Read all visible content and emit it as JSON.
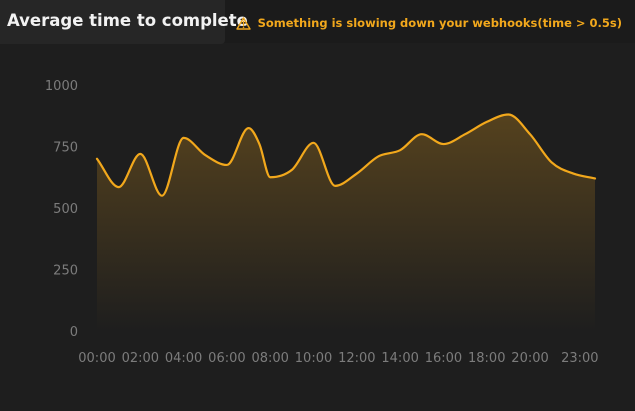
{
  "header": {
    "title": "Average time to complete",
    "warning_text": "Something is slowing down your webhooks(time > 0.5s)",
    "warning_icon": "warning-triangle-icon",
    "warning_color": "#f2a81c"
  },
  "chart_data": {
    "type": "area",
    "title": "Average time to complete",
    "xlabel": "",
    "ylabel": "",
    "ylim": [
      0,
      1000
    ],
    "xlim": [
      0,
      23
    ],
    "y_ticks": [
      0,
      250,
      500,
      750,
      1000
    ],
    "x_ticks": [
      {
        "value": 0,
        "label": "00:00"
      },
      {
        "value": 2,
        "label": "02:00"
      },
      {
        "value": 4,
        "label": "04:00"
      },
      {
        "value": 6,
        "label": "06:00"
      },
      {
        "value": 8,
        "label": "08:00"
      },
      {
        "value": 10,
        "label": "10:00"
      },
      {
        "value": 12,
        "label": "12:00"
      },
      {
        "value": 14,
        "label": "14:00"
      },
      {
        "value": 16,
        "label": "16:00"
      },
      {
        "value": 18,
        "label": "18:00"
      },
      {
        "value": 20,
        "label": "20:00"
      },
      {
        "value": 22.3,
        "label": "23:00"
      }
    ],
    "grid": false,
    "legend": "none",
    "series": [
      {
        "color": "#f2a81c",
        "x": [
          0,
          1,
          2,
          3,
          4,
          5,
          6,
          7,
          7.5,
          8,
          9,
          10,
          11,
          12,
          13,
          14,
          15,
          16,
          17,
          18,
          19,
          20,
          21,
          22,
          23
        ],
        "values": [
          700,
          585,
          720,
          550,
          785,
          715,
          675,
          825,
          760,
          625,
          655,
          765,
          590,
          640,
          710,
          735,
          800,
          760,
          800,
          850,
          880,
          800,
          685,
          640,
          620
        ]
      }
    ]
  }
}
